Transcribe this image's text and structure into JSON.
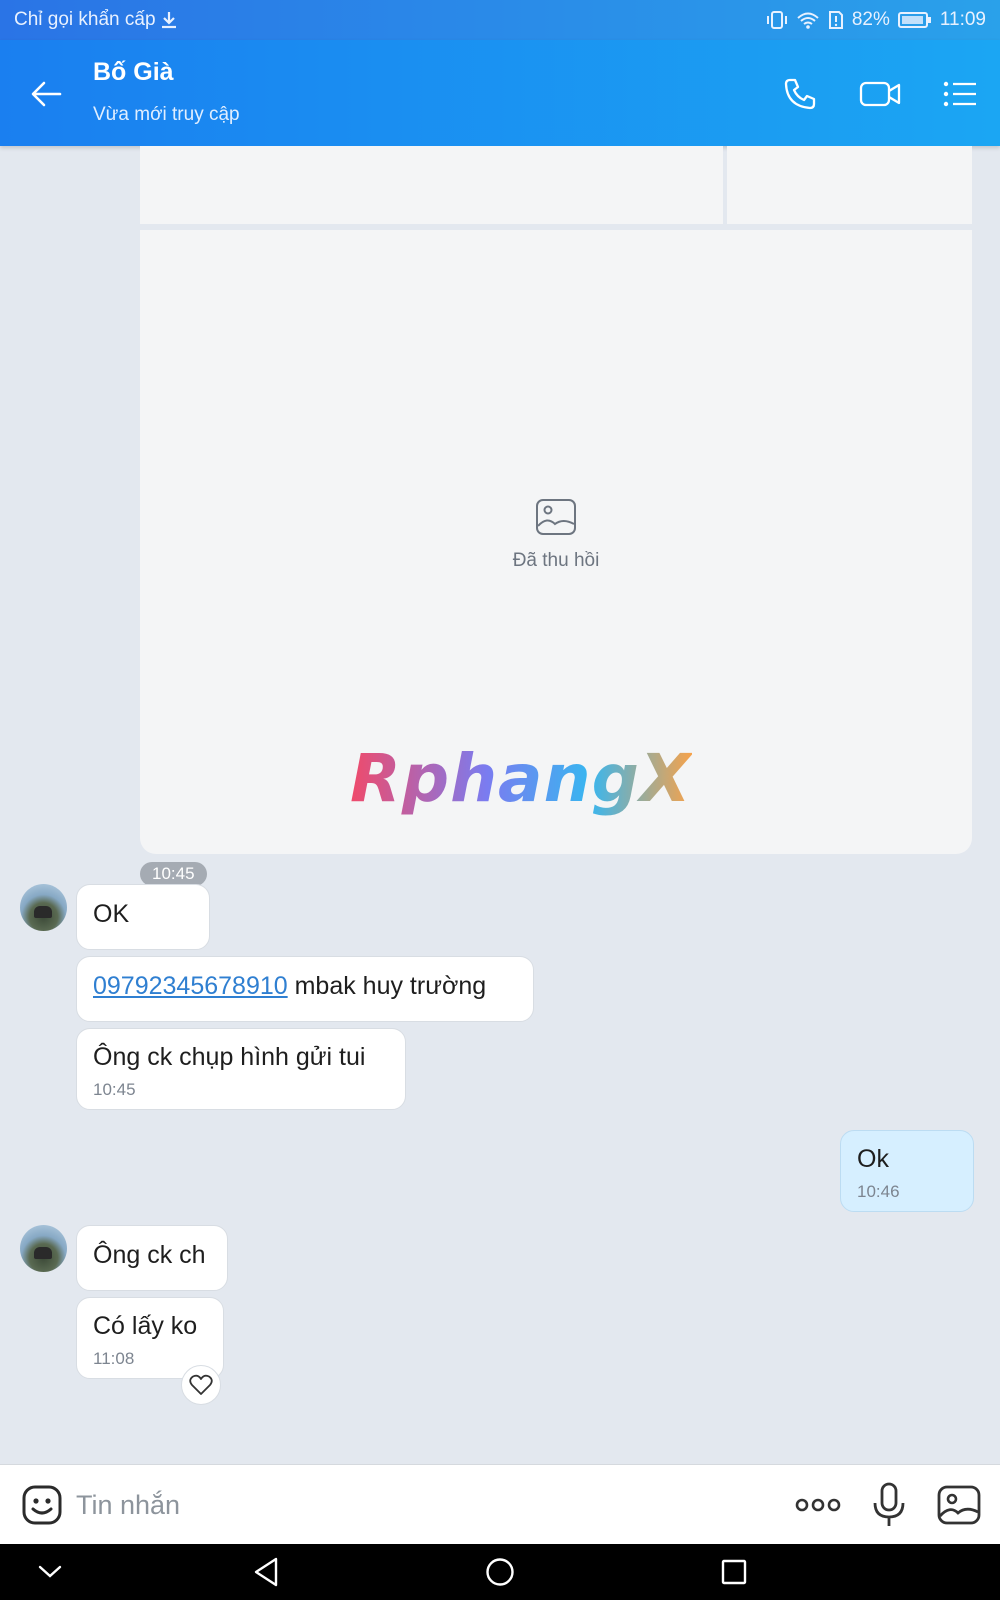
{
  "status_bar": {
    "left_text": "Chỉ gọi khẩn cấp",
    "battery": "82%",
    "time": "11:09",
    "icons": [
      "download-icon",
      "vibrate-icon",
      "wifi-icon",
      "sim-alert-icon",
      "battery-icon"
    ]
  },
  "header": {
    "title": "Bố Già",
    "subtitle": "Vừa mới truy cập",
    "icons": [
      "back-arrow-icon",
      "phone-icon",
      "video-camera-icon",
      "list-menu-icon"
    ]
  },
  "chat": {
    "recalled_image": {
      "label": "Đã thu hồi",
      "icon": "image-icon"
    },
    "watermark": "RphangX",
    "first_time": "10:45",
    "messages": [
      {
        "sender": "other",
        "text": "OK"
      },
      {
        "sender": "other",
        "phone": "09792345678910",
        "text": " mbak huy trường"
      },
      {
        "sender": "other",
        "text": "Ông ck chụp hình gửi tui",
        "time": "10:45"
      },
      {
        "sender": "me",
        "text": "Ok",
        "time": "10:46"
      },
      {
        "sender": "other",
        "text": "Ông ck ch"
      },
      {
        "sender": "other",
        "text": "Có lấy ko",
        "time": "11:08"
      }
    ]
  },
  "input": {
    "placeholder": "Tin nhắn",
    "icons": [
      "emoji-icon",
      "more-dots-icon",
      "microphone-icon",
      "gallery-icon"
    ]
  },
  "nav_bar": {
    "icons": [
      "collapse-icon",
      "back-triangle-icon",
      "home-circle-icon",
      "recents-square-icon"
    ]
  },
  "colors": {
    "header_start": "#1a7ff0",
    "header_end": "#1ba6f3",
    "chat_bg": "#e3e8ef",
    "my_bubble": "#d6efff",
    "link": "#2f7fd1"
  }
}
